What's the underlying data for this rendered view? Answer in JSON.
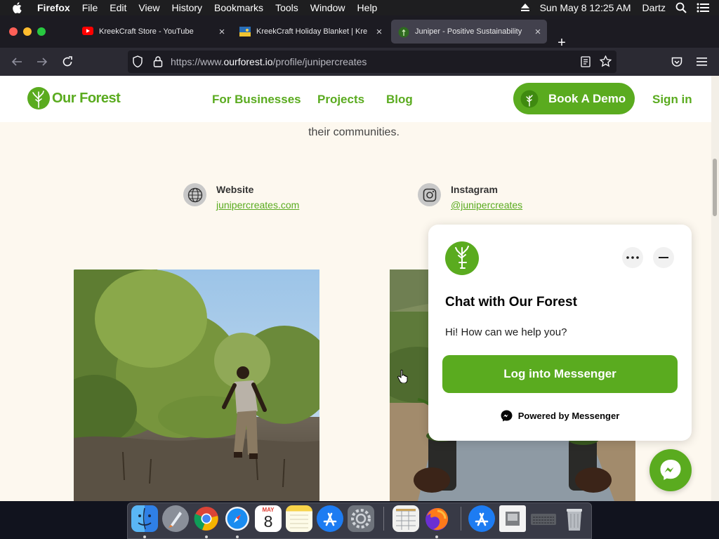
{
  "menubar": {
    "app": "Firefox",
    "items": [
      "File",
      "Edit",
      "View",
      "History",
      "Bookmarks",
      "Tools",
      "Window",
      "Help"
    ],
    "clock": "Sun May 8  12:25 AM",
    "user": "Dartz"
  },
  "tabs": [
    {
      "title": "KreekCraft Store - YouTube"
    },
    {
      "title": "KreekCraft Holiday Blanket | Kre"
    },
    {
      "title": "Juniper - Positive Sustainability"
    }
  ],
  "url": {
    "prefix": "https://www.",
    "domain": "ourforest.io",
    "path": "/profile/junipercreates"
  },
  "site": {
    "logo_text": "Our Forest",
    "nav": [
      "For Businesses",
      "Projects",
      "Blog"
    ],
    "book_demo": "Book A Demo",
    "signin": "Sign in",
    "tagline": "their communities.",
    "website_label": "Website",
    "website_link": "junipercreates.com",
    "instagram_label": "Instagram",
    "instagram_link": "@junipercreates"
  },
  "chat": {
    "title": "Chat with Our Forest",
    "greeting": "Hi! How can we help you?",
    "login_button": "Log into Messenger",
    "powered_by": "Powered by Messenger"
  },
  "dock": {
    "apps": [
      "finder-icon",
      "launchpad-icon",
      "chrome-icon",
      "safari-icon",
      "calendar-icon",
      "notes-icon",
      "app-store-icon",
      "system-preferences-icon",
      "numbers-icon",
      "firefox-icon",
      "app-store-downloads-icon",
      "preview-icon",
      "keyboard-icon",
      "trash-icon"
    ],
    "calendar_month": "MAY",
    "calendar_day": "8"
  },
  "colors": {
    "brand_green": "#5aab1f",
    "page_bg": "#fdf8ef",
    "tab_active": "#42414d"
  }
}
